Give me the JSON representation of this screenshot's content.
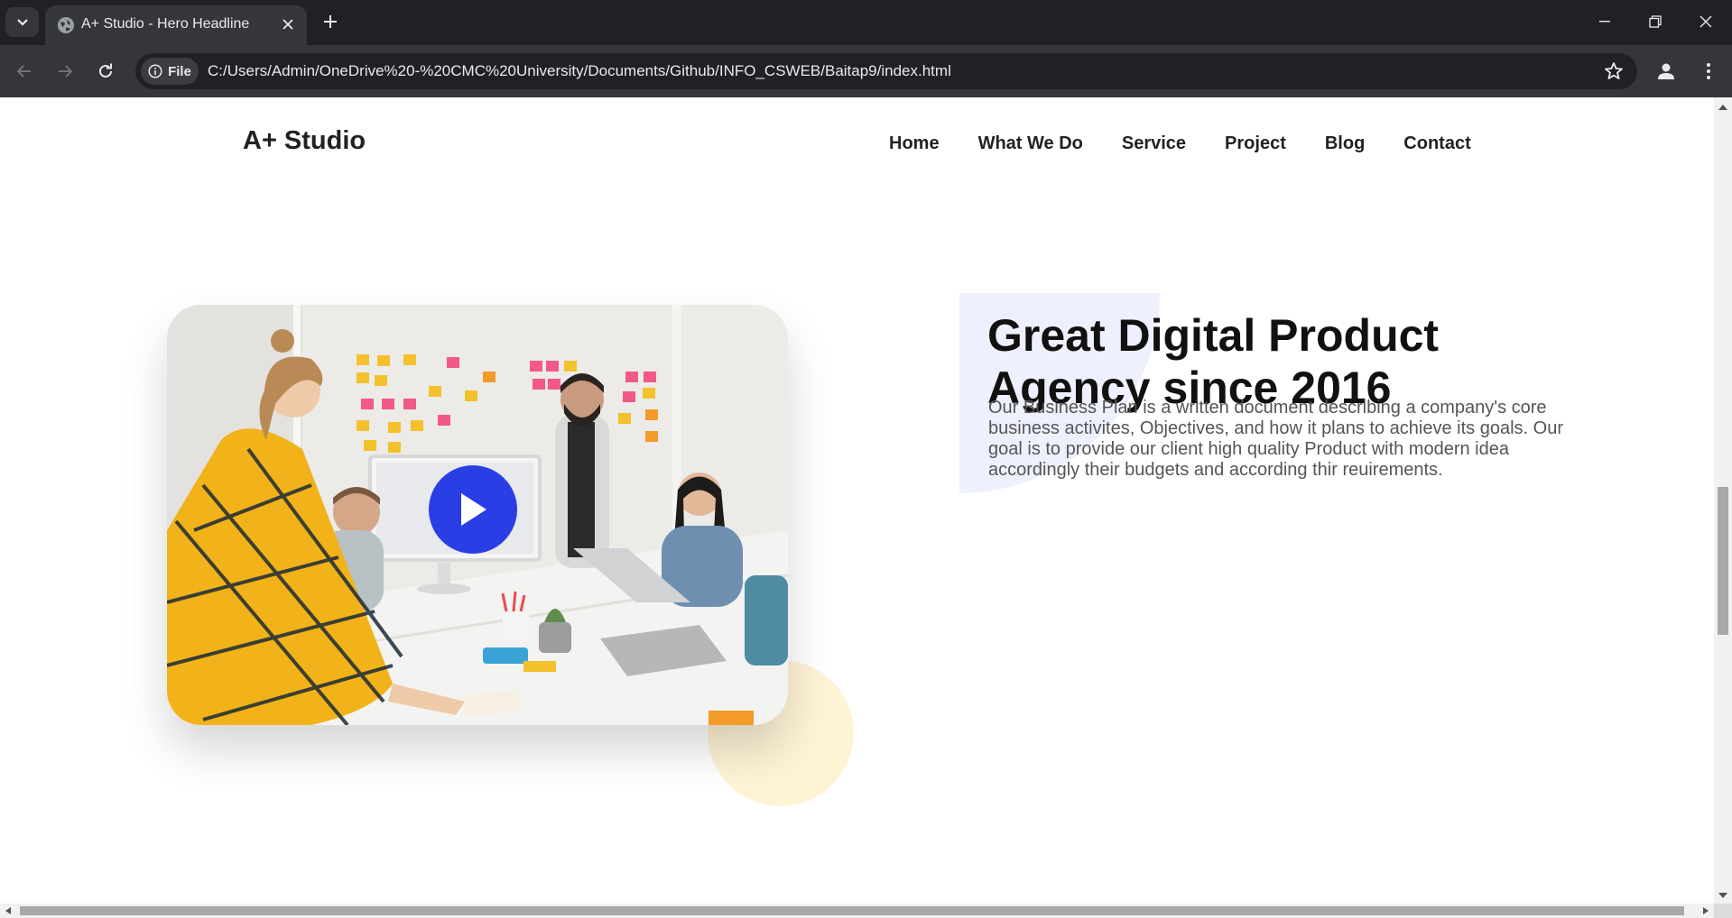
{
  "browser": {
    "tab_title": "A+ Studio - Hero Headline",
    "site_chip_label": "File",
    "url": "C:/Users/Admin/OneDrive%20-%20CMC%20University/Documents/Github/INFO_CSWEB/Baitap9/index.html"
  },
  "site": {
    "logo": "A+ Studio",
    "nav": [
      "Home",
      "What We Do",
      "Service",
      "Project",
      "Blog",
      "Contact"
    ]
  },
  "hero": {
    "headline": "Great Digital Product Agency since 2016",
    "description": "Our Business Plan is a written document describing a company's core business activites, Objectives, and how it plans to achieve its goals. Our goal is to provide our client high quality Product with modern idea accordingly their budgets and according thir reuirements."
  },
  "colors": {
    "play_button": "#2a3ee6",
    "accent_blue_shape": "#eef0fd",
    "accent_yellow_circle": "#fff3d6",
    "chrome_dark": "#202124",
    "chrome_toolbar": "#35363a"
  },
  "icons": [
    "tab-search-icon",
    "globe-favicon-icon",
    "close-icon",
    "plus-icon",
    "minimize-icon",
    "restore-icon",
    "window-close-icon",
    "back-arrow-icon",
    "forward-arrow-icon",
    "reload-icon",
    "info-icon",
    "star-icon",
    "profile-icon",
    "more-vert-icon",
    "play-icon"
  ]
}
